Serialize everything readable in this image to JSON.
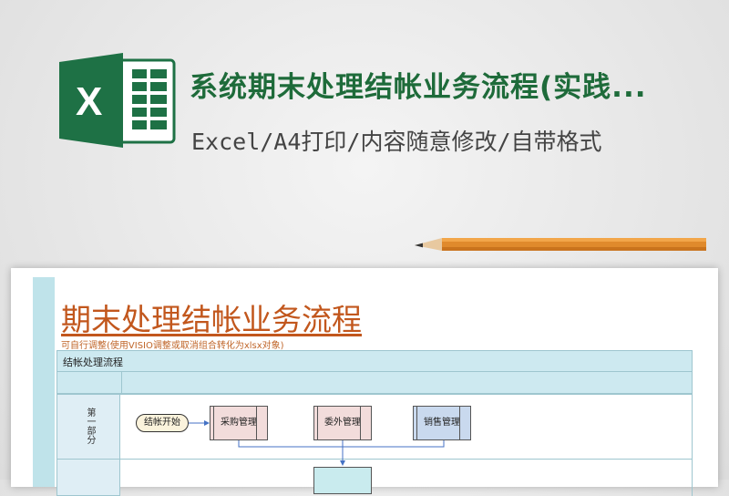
{
  "header": {
    "title": "系统期末处理结帐业务流程(实践...",
    "subtitle": "Excel/A4打印/内容随意修改/自带格式"
  },
  "logo": {
    "icon": "excel-icon",
    "letter": "X",
    "brand_color": "#1e7145"
  },
  "document": {
    "title": "期末处理结帐业务流程",
    "note": "可自行调整(使用VISIO调整或取消组合转化为xlsx对象)",
    "table_header": "结帐处理流程",
    "lane_label": "第一部分",
    "nodes": {
      "start": "结帐开始",
      "purchase": "采购管理",
      "outsource": "委外管理",
      "sales": "销售管理"
    }
  },
  "colors": {
    "title_green": "#1e6b3a",
    "doc_title_orange": "#c2571d",
    "table_fill": "#cde9f0"
  }
}
